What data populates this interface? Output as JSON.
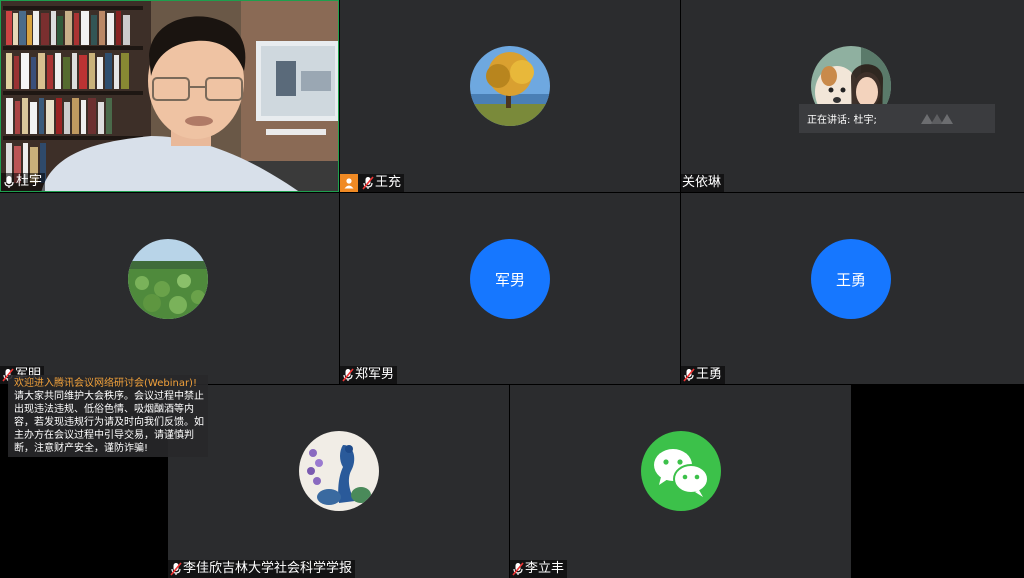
{
  "participants": [
    {
      "name": "杜宇"
    },
    {
      "name": "王充"
    },
    {
      "name": "关依琳"
    },
    {
      "name": "军明"
    },
    {
      "name": "郑军男",
      "avatar_text": "军男"
    },
    {
      "name": "王勇",
      "avatar_text": "王勇"
    },
    {
      "name": "李佳欣吉林大学社会科学学报"
    },
    {
      "name": "李立丰"
    }
  ],
  "speaking": "正在讲话: 杜宇;",
  "notice": {
    "title": "欢迎进入腾讯会议网络研讨会(Webinar)!",
    "body": "请大家共同维护大会秩序。会议过程中禁止出现违法违规、低俗色情、吸烟酗酒等内容，若发现违规行为请及时向我们反馈。如主办方在会议过程中引导交易，请谨慎判断，注意财产安全，谨防诈骗!"
  },
  "colors": {
    "tile_bg": "#2b2c2e",
    "avatar_blue": "#1677ff",
    "active_border": "#1e9f4e",
    "host_badge": "#f08a24",
    "wechat_green": "#3cc14a"
  }
}
